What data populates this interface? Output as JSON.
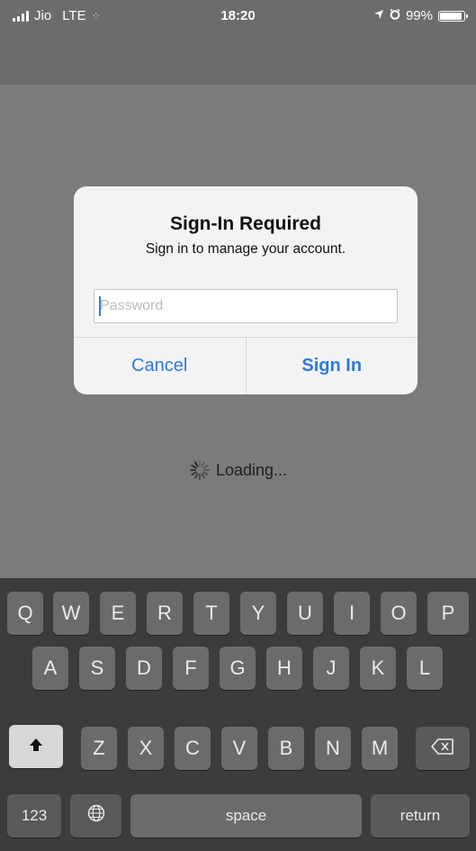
{
  "status_bar": {
    "carrier": "Jio",
    "network": "LTE",
    "time": "18:20",
    "battery": "99%",
    "battery_level": 0.99
  },
  "alert": {
    "title": "Sign-In Required",
    "message": "Sign in to manage your account.",
    "password_placeholder": "Password",
    "cancel_label": "Cancel",
    "signin_label": "Sign In"
  },
  "loading_label": "Loading...",
  "keyboard": {
    "row1": [
      "Q",
      "W",
      "E",
      "R",
      "T",
      "Y",
      "U",
      "I",
      "O",
      "P"
    ],
    "row2": [
      "A",
      "S",
      "D",
      "F",
      "G",
      "H",
      "J",
      "K",
      "L"
    ],
    "row3": [
      "Z",
      "X",
      "C",
      "V",
      "B",
      "N",
      "M"
    ],
    "numbers_label": "123",
    "space_label": "space",
    "return_label": "return"
  },
  "icons": {
    "shift": "shift-arrow-icon",
    "delete": "backspace-icon",
    "globe": "globe-icon",
    "location": "location-arrow-icon",
    "alarm": "alarm-icon",
    "spinner": "activity-spinner-icon"
  }
}
